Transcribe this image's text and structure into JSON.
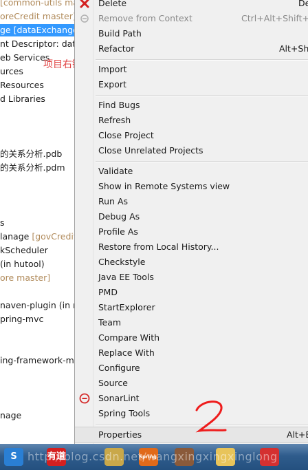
{
  "explorer": {
    "rows": [
      {
        "text": "",
        "dim": "[common-utils ma",
        "selected": false
      },
      {
        "text": "",
        "dim": "oreCredit master]",
        "selected": false
      },
      {
        "text": "ge [dataExchange",
        "dim": "",
        "selected": true
      },
      {
        "text": "nt Descriptor: data",
        "dim": "",
        "selected": false
      },
      {
        "text": "eb Services",
        "dim": "",
        "selected": false
      },
      {
        "text": "urces",
        "dim": "",
        "selected": false
      },
      {
        "text": "Resources",
        "dim": "",
        "selected": false
      },
      {
        "text": "d Libraries",
        "dim": "",
        "selected": false
      },
      {
        "text": "",
        "dim": "",
        "selected": false
      },
      {
        "text": "",
        "dim": "",
        "selected": false
      },
      {
        "text": "",
        "dim": "",
        "selected": false
      },
      {
        "text": "的关系分析.pdb",
        "dim": "",
        "selected": false
      },
      {
        "text": "的关系分析.pdm",
        "dim": "",
        "selected": false
      },
      {
        "text": "",
        "dim": "",
        "selected": false
      },
      {
        "text": "",
        "dim": "",
        "selected": false
      },
      {
        "text": "",
        "dim": "",
        "selected": false
      },
      {
        "text": "s",
        "dim": "",
        "selected": false
      },
      {
        "text": "lanage ",
        "dim": "[govCreditM",
        "selected": false
      },
      {
        "text": "kScheduler",
        "dim": "",
        "selected": false
      },
      {
        "text": " (in hutool)",
        "dim": "",
        "selected": false
      },
      {
        "text": "",
        "dim": "ore master]",
        "selected": false
      },
      {
        "text": "",
        "dim": "",
        "selected": false
      },
      {
        "text": "naven-plugin (in my",
        "dim": "",
        "selected": false
      },
      {
        "text": "pring-mvc",
        "dim": "",
        "selected": false
      },
      {
        "text": "",
        "dim": "",
        "selected": false
      },
      {
        "text": "",
        "dim": "",
        "selected": false
      },
      {
        "text": "ing-framework-ma",
        "dim": "",
        "selected": false
      },
      {
        "text": "",
        "dim": "",
        "selected": false
      },
      {
        "text": "",
        "dim": "",
        "selected": false
      },
      {
        "text": "",
        "dim": "",
        "selected": false
      },
      {
        "text": "nage",
        "dim": "",
        "selected": false
      },
      {
        "text": "",
        "dim": "",
        "selected": false
      }
    ],
    "annotation": "项目右键"
  },
  "menu": {
    "items": [
      {
        "label": "Delete",
        "accel": "De",
        "icon": "delete-icon",
        "disabled": false
      },
      {
        "label": "Remove from Context",
        "accel": "Ctrl+Alt+Shift+D",
        "icon": "remove-context-icon",
        "disabled": true
      },
      {
        "label": "Build Path",
        "accel": "",
        "icon": "",
        "disabled": false
      },
      {
        "label": "Refactor",
        "accel": "Alt+Shi",
        "icon": "",
        "disabled": false
      },
      {
        "sep": true
      },
      {
        "label": "Import",
        "accel": "",
        "icon": "",
        "disabled": false
      },
      {
        "label": "Export",
        "accel": "",
        "icon": "",
        "disabled": false
      },
      {
        "sep": true
      },
      {
        "label": "Find Bugs",
        "accel": "",
        "icon": "",
        "disabled": false
      },
      {
        "label": "Refresh",
        "accel": "",
        "icon": "",
        "disabled": false
      },
      {
        "label": "Close Project",
        "accel": "",
        "icon": "",
        "disabled": false
      },
      {
        "label": "Close Unrelated Projects",
        "accel": "",
        "icon": "",
        "disabled": false
      },
      {
        "sep": true
      },
      {
        "label": "Validate",
        "accel": "",
        "icon": "",
        "disabled": false
      },
      {
        "label": "Show in Remote Systems view",
        "accel": "",
        "icon": "",
        "disabled": false
      },
      {
        "label": "Run As",
        "accel": "",
        "icon": "",
        "disabled": false
      },
      {
        "label": "Debug As",
        "accel": "",
        "icon": "",
        "disabled": false
      },
      {
        "label": "Profile As",
        "accel": "",
        "icon": "",
        "disabled": false
      },
      {
        "label": "Restore from Local History...",
        "accel": "",
        "icon": "",
        "disabled": false
      },
      {
        "label": "Checkstyle",
        "accel": "",
        "icon": "",
        "disabled": false
      },
      {
        "label": "Java EE Tools",
        "accel": "",
        "icon": "",
        "disabled": false
      },
      {
        "label": "PMD",
        "accel": "",
        "icon": "",
        "disabled": false
      },
      {
        "label": "StartExplorer",
        "accel": "",
        "icon": "",
        "disabled": false
      },
      {
        "label": "Team",
        "accel": "",
        "icon": "",
        "disabled": false
      },
      {
        "label": "Compare With",
        "accel": "",
        "icon": "",
        "disabled": false
      },
      {
        "label": "Replace With",
        "accel": "",
        "icon": "",
        "disabled": false
      },
      {
        "label": "Configure",
        "accel": "",
        "icon": "",
        "disabled": false
      },
      {
        "label": "Source",
        "accel": "",
        "icon": "",
        "disabled": false
      },
      {
        "label": "SonarLint",
        "accel": "",
        "icon": "sonarlint-icon",
        "disabled": false
      },
      {
        "label": "Spring Tools",
        "accel": "",
        "icon": "",
        "disabled": false
      },
      {
        "sep": true
      },
      {
        "label": "Properties",
        "accel": "Alt+E",
        "icon": "",
        "disabled": false,
        "hover": true
      }
    ],
    "annotation": "2"
  },
  "taskbar": {
    "apps": [
      {
        "name": "sogou-input-icon",
        "label": "S",
        "color": "#2a7fd4"
      },
      {
        "name": "youdao-dict-icon",
        "label": "有道",
        "color": "#d42020"
      },
      {
        "name": "eclipse-mars-icon",
        "label": "",
        "color": "#c9a84a"
      },
      {
        "name": "spring-ide-icon",
        "label": "Spring IDE",
        "color": "#e06a1a"
      },
      {
        "name": "toolbox-icon",
        "label": "",
        "color": "#8a5a3a"
      },
      {
        "name": "file-explorer-icon",
        "label": "",
        "color": "#e8c45a"
      },
      {
        "name": "xmind-icon",
        "label": "",
        "color": "#d43030"
      }
    ],
    "watermark": "http://blog.csdn.net/wangxingxingxinglong"
  }
}
